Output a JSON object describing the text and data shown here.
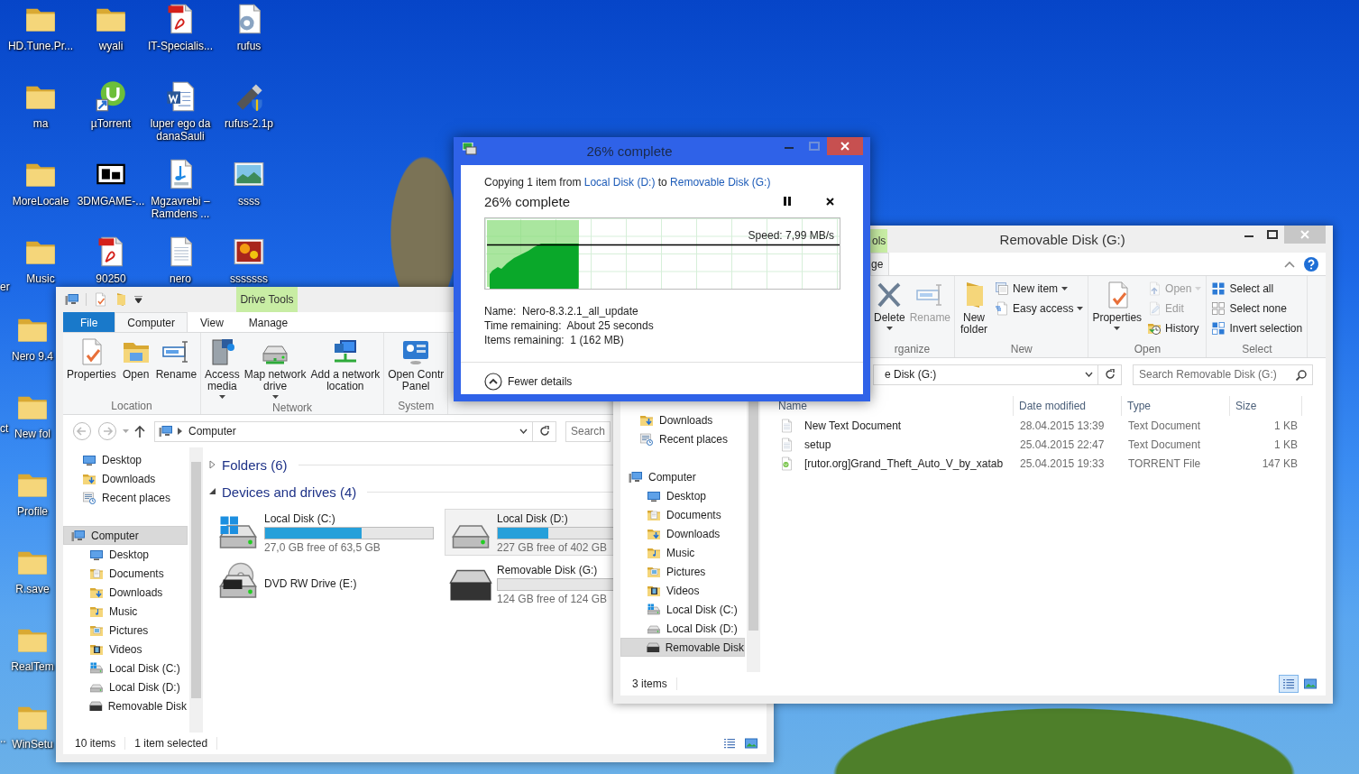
{
  "desktop": {
    "icons": [
      {
        "label": "HD.Tune.Pr...",
        "kind": "folder"
      },
      {
        "label": "wyali",
        "kind": "folder"
      },
      {
        "label": "IT-Specialis...",
        "kind": "pdf"
      },
      {
        "label": "rufus",
        "kind": "settings-doc"
      },
      {
        "label": "ma",
        "kind": "folder"
      },
      {
        "label": "µTorrent",
        "kind": "utorrent"
      },
      {
        "label": "luper ego da\ndanaSauli",
        "kind": "word"
      },
      {
        "label": "rufus-2.1p",
        "kind": "usb"
      },
      {
        "label": "MoreLocale",
        "kind": "folder"
      },
      {
        "label": "3DMGAME-...",
        "kind": "archive"
      },
      {
        "label": "Mgzavrebi –\nRamdens ...",
        "kind": "mp3"
      },
      {
        "label": "ssss",
        "kind": "image"
      },
      {
        "label": "Music",
        "kind": "folder"
      },
      {
        "label": "90250",
        "kind": "pdf"
      },
      {
        "label": "nero",
        "kind": "text"
      },
      {
        "label": "sssssss",
        "kind": "photo"
      }
    ],
    "covered_icons": [
      {
        "label": "Nero 9.4",
        "kind": "folder"
      },
      {
        "label": "New fol",
        "kind": "folder"
      },
      {
        "label": "Profile",
        "kind": "folder"
      },
      {
        "label": "R.save",
        "kind": "folder"
      },
      {
        "label": "RealTem",
        "kind": "folder"
      },
      {
        "label": "WinSetu",
        "kind": "folder"
      }
    ],
    "edge_labels": [
      "er",
      "ct",
      ".."
    ]
  },
  "computer_window": {
    "context_tab": "Drive Tools",
    "tabs": [
      {
        "label": "File",
        "kind": "menu",
        "selected": false
      },
      {
        "label": "Computer",
        "kind": "tab",
        "selected": true
      },
      {
        "label": "View",
        "kind": "tab",
        "selected": false
      },
      {
        "label": "Manage",
        "kind": "tab",
        "selected": false
      }
    ],
    "ribbon": [
      {
        "label": "Location",
        "buttons": [
          {
            "label": "Properties",
            "kind": "properties"
          },
          {
            "label": "Open",
            "kind": "open"
          },
          {
            "label": "Rename",
            "kind": "rename"
          }
        ]
      },
      {
        "label": "Network",
        "buttons": [
          {
            "label": "Access\nmedia",
            "kind": "media",
            "menu": true
          },
          {
            "label": "Map network\ndrive",
            "kind": "map-drive",
            "menu": true
          },
          {
            "label": "Add a network\nlocation",
            "kind": "network-location"
          }
        ]
      },
      {
        "label": "System",
        "buttons": [
          {
            "label": "Open Contr\nPanel",
            "kind": "control-panel"
          }
        ]
      }
    ],
    "address": "Computer",
    "search": {
      "placeholder": "Search"
    },
    "nav": {
      "favorites": [
        {
          "label": "Desktop",
          "kind": "desktop",
          "selected": false
        },
        {
          "label": "Downloads",
          "kind": "downloads",
          "selected": false
        },
        {
          "label": "Recent places",
          "kind": "recent",
          "selected": false
        }
      ],
      "tree": [
        {
          "label": "Computer",
          "kind": "computer",
          "selected": true,
          "children": [
            {
              "label": "Desktop",
              "kind": "desktop",
              "selected": false
            },
            {
              "label": "Documents",
              "kind": "documents",
              "selected": false
            },
            {
              "label": "Downloads",
              "kind": "downloads",
              "selected": false
            },
            {
              "label": "Music",
              "kind": "music",
              "selected": false
            },
            {
              "label": "Pictures",
              "kind": "pictures",
              "selected": false
            },
            {
              "label": "Videos",
              "kind": "videos",
              "selected": false
            },
            {
              "label": "Local Disk (C:)",
              "kind": "system-drive",
              "selected": false
            },
            {
              "label": "Local Disk (D:)",
              "kind": "drive",
              "selected": false
            },
            {
              "label": "Removable Disk",
              "kind": "removable",
              "selected": false
            }
          ]
        }
      ]
    },
    "groups": [
      {
        "label": "Folders (6)",
        "expanded": false
      },
      {
        "label": "Devices and drives (4)",
        "expanded": true
      }
    ],
    "drives": [
      {
        "name": "Local Disk (C:)",
        "kind": "system-drive",
        "level": 0.575,
        "free": "27,0 GB free of 63,5 GB",
        "selected": false
      },
      {
        "name": "DVD RW Drive (E:)",
        "kind": "dvd",
        "selected": false
      },
      {
        "name": "Local Disk (D:)",
        "kind": "drive",
        "level": 0.435,
        "free": "227 GB free of 402 GB",
        "selected": true
      },
      {
        "name": "Removable Disk (G:)",
        "kind": "removable",
        "level": 0,
        "free": "124 GB free of 124 GB",
        "selected": false
      }
    ],
    "status": [
      "10 items",
      "1 item selected"
    ],
    "views": [
      {
        "kind": "details",
        "selected": false
      },
      {
        "kind": "large-icons",
        "selected": false
      }
    ]
  },
  "removable_window": {
    "title": "Removable Disk (G:)",
    "context_tab": "ols",
    "tabs": [
      {
        "label": "ge",
        "selected": true
      }
    ],
    "ribbon": [
      {
        "label": "rganize",
        "buttons": [
          {
            "label": "Delete",
            "kind": "delete",
            "menu": true,
            "disabled": false
          },
          {
            "label": "Rename",
            "kind": "rename",
            "disabled": true
          }
        ]
      },
      {
        "label": "New",
        "buttons": [
          {
            "label": "New\nfolder",
            "kind": "new-folder",
            "disabled": false
          },
          {
            "label": "New item",
            "kind": "new-item",
            "menu": true,
            "disabled": false
          },
          {
            "label": "Easy access",
            "kind": "easy-access",
            "menu": true,
            "disabled": false
          }
        ]
      },
      {
        "label": "Open",
        "buttons": [
          {
            "label": "Properties",
            "kind": "properties",
            "menu": true,
            "disabled": false
          },
          {
            "label": "Open",
            "kind": "open-small",
            "menu": true,
            "disabled": true
          },
          {
            "label": "Edit",
            "kind": "edit",
            "disabled": true
          },
          {
            "label": "History",
            "kind": "history",
            "disabled": false
          }
        ]
      },
      {
        "label": "Select",
        "buttons": [
          {
            "label": "Select all",
            "kind": "select-all",
            "disabled": false
          },
          {
            "label": "Select none",
            "kind": "select-none",
            "disabled": false
          },
          {
            "label": "Invert selection",
            "kind": "invert-selection",
            "disabled": false
          }
        ]
      }
    ],
    "address": "e Disk (G:)",
    "search": {
      "placeholder": "Search Removable Disk (G:)"
    },
    "nav": {
      "favorites": [
        {
          "label": "Downloads",
          "kind": "downloads",
          "selected": false
        },
        {
          "label": "Recent places",
          "kind": "recent",
          "selected": false
        }
      ],
      "tree": [
        {
          "label": "Computer",
          "kind": "computer",
          "selected": false,
          "children": [
            {
              "label": "Desktop",
              "kind": "desktop",
              "selected": false
            },
            {
              "label": "Documents",
              "kind": "documents",
              "selected": false
            },
            {
              "label": "Downloads",
              "kind": "downloads",
              "selected": false
            },
            {
              "label": "Music",
              "kind": "music",
              "selected": false
            },
            {
              "label": "Pictures",
              "kind": "pictures",
              "selected": false
            },
            {
              "label": "Videos",
              "kind": "videos",
              "selected": false
            },
            {
              "label": "Local Disk (C:)",
              "kind": "system-drive",
              "selected": false
            },
            {
              "label": "Local Disk (D:)",
              "kind": "drive",
              "selected": false
            },
            {
              "label": "Removable Disk",
              "kind": "removable",
              "selected": true
            }
          ]
        }
      ]
    },
    "columns": [
      "Name",
      "Date modified",
      "Type",
      "Size"
    ],
    "files": [
      {
        "name": "New Text Document",
        "kind": "text",
        "date": "28.04.2015 13:39",
        "type": "Text Document",
        "size": "1 KB",
        "selected": false
      },
      {
        "name": "setup",
        "kind": "text",
        "date": "25.04.2015 22:47",
        "type": "Text Document",
        "size": "1 KB",
        "selected": false
      },
      {
        "name": "[rutor.org]Grand_Theft_Auto_V_by_xatab",
        "kind": "torrent",
        "date": "25.04.2015 19:33",
        "type": "TORRENT File",
        "size": "147 KB",
        "selected": false
      }
    ],
    "status": "3 items",
    "views": [
      {
        "kind": "details",
        "selected": true
      },
      {
        "kind": "large-icons",
        "selected": false
      }
    ]
  },
  "copy_dialog": {
    "title": "26% complete",
    "message": {
      "prefix": "Copying 1 item from",
      "source": "Local Disk (D:)",
      "joiner": "to",
      "destination": "Removable Disk (G:)"
    },
    "heading": "26% complete",
    "progress": {
      "level": 0.26,
      "speed": "Speed: 7,99 MB/s"
    },
    "details": [
      "Name:  Nero-8.3.2.1_all_update",
      "Time remaining:  About 25 seconds",
      "Items remaining:  1 (162 MB)"
    ],
    "toggle": "Fewer details"
  }
}
